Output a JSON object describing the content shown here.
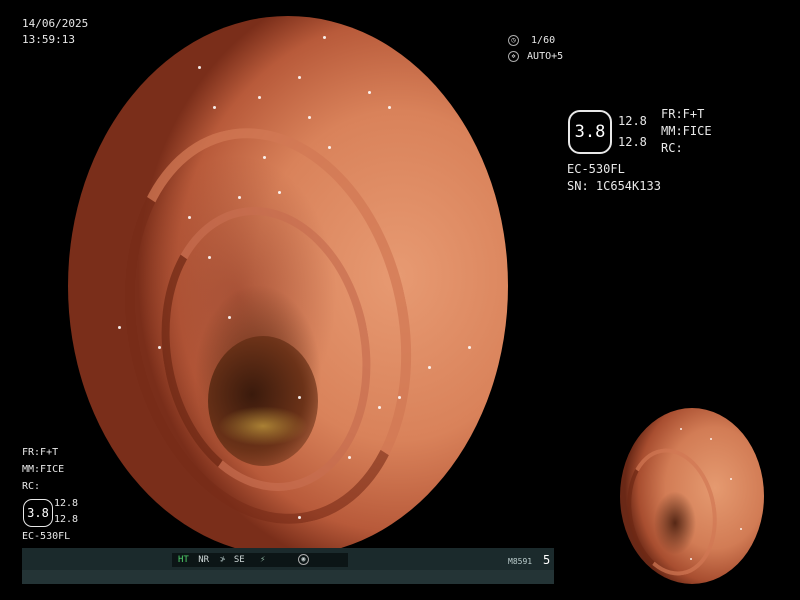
{
  "datetime": {
    "date": "14/06/2025",
    "time": "13:59:13"
  },
  "exposure": {
    "shutter": "1/60",
    "auto": "AUTO+5"
  },
  "right_panel": {
    "hex_value": "3.8",
    "value_top": "12.8",
    "value_bottom": "12.8",
    "fr": "FR:F+T",
    "mm": "MM:FICE",
    "rc": "RC:",
    "scope_model": "EC-530FL",
    "serial": "SN: 1C654K133"
  },
  "left_panel": {
    "fr": "FR:F+T",
    "mm": "MM:FICE",
    "rc": "RC:",
    "hex_value": "3.8",
    "value_top": "12.8",
    "value_bottom": "12.8",
    "scope_model": "EC-530FL"
  },
  "status_bar": {
    "ht": "HT",
    "nr": "NR",
    "se": "SE",
    "code": "M8591",
    "number": "5"
  },
  "colors": {
    "ht_green": "#4fd06a",
    "bar_bg": "#1b2a2c"
  }
}
